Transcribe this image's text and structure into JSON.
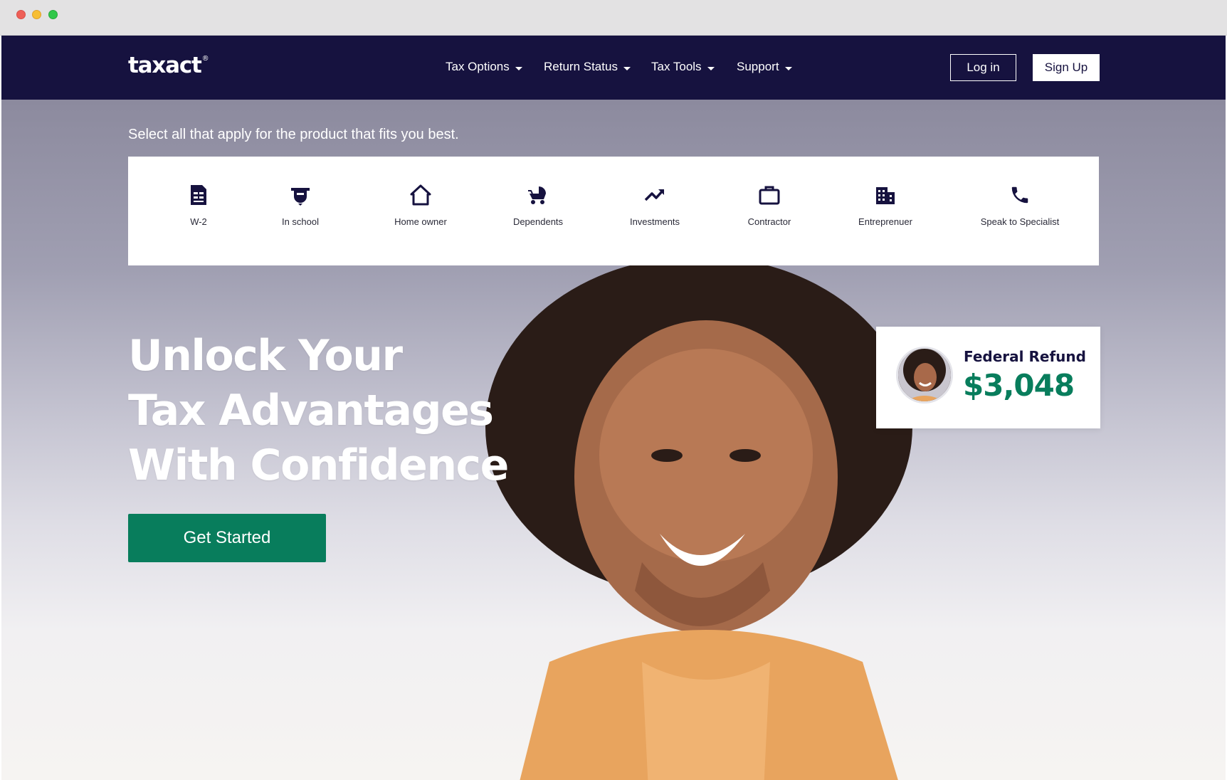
{
  "nav": {
    "logo": "taxact",
    "logo_mark": "®",
    "links": [
      {
        "label": "Tax Options"
      },
      {
        "label": "Return Status"
      },
      {
        "label": "Tax Tools"
      },
      {
        "label": "Support"
      }
    ],
    "login_label": "Log in",
    "signup_label": "Sign Up"
  },
  "hero": {
    "subtitle": "Select all that apply for the product that fits you best.",
    "options": [
      {
        "label": "W-2",
        "icon": "document-icon"
      },
      {
        "label": "In school",
        "icon": "graduation-cap-icon"
      },
      {
        "label": "Home owner",
        "icon": "house-icon"
      },
      {
        "label": "Dependents",
        "icon": "stroller-icon"
      },
      {
        "label": "Investments",
        "icon": "trending-up-icon"
      },
      {
        "label": "Contractor",
        "icon": "briefcase-icon"
      },
      {
        "label": "Entreprenuer",
        "icon": "building-icon"
      },
      {
        "label": "Speak to Specialist",
        "icon": "phone-icon"
      }
    ],
    "headline": [
      "Unlock Your",
      "Tax Advantages",
      "With Confidence"
    ],
    "cta_label": "Get Started"
  },
  "refund": {
    "label": "Federal Refund",
    "amount": "$3,048"
  },
  "colors": {
    "navy": "#16123f",
    "green": "#087d5c",
    "white": "#ffffff"
  }
}
